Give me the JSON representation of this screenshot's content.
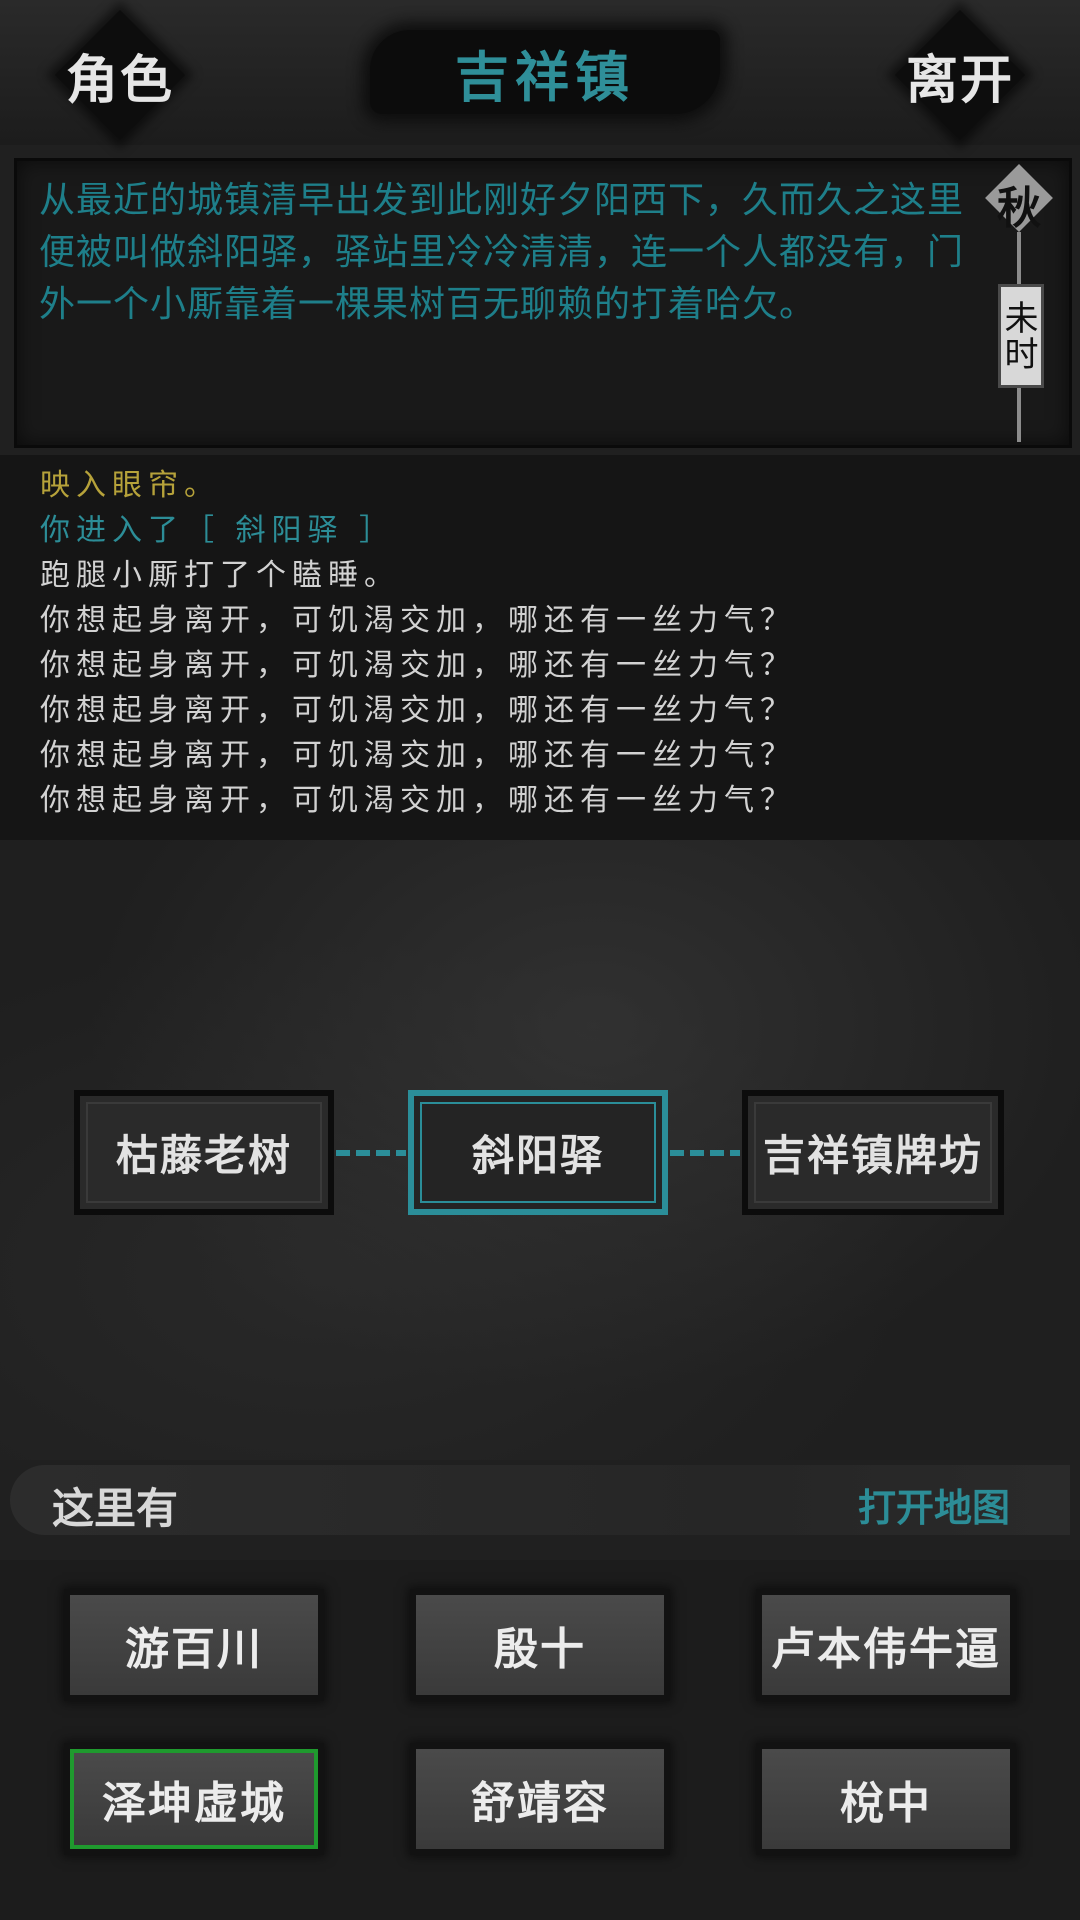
{
  "header": {
    "role_button": "角色",
    "title": "吉祥镇",
    "leave_button": "离开"
  },
  "description": {
    "text": "从最近的城镇清早出发到此刚好夕阳西下，久而久之这里便被叫做斜阳驿，驿站里冷冷清清，连一个人都没有，门外一个小厮靠着一棵果树百无聊赖的打着哈欠。"
  },
  "season": {
    "season": "秋",
    "time": "未时"
  },
  "log": {
    "lines": [
      "映入眼帘。",
      "你进入了［ 斜阳驿 ］",
      "跑腿小厮打了个瞌睡。",
      "你想起身离开，可饥渴交加，哪还有一丝力气？",
      "你想起身离开，可饥渴交加，哪还有一丝力气？",
      "你想起身离开，可饥渴交加，哪还有一丝力气？",
      "你想起身离开，可饥渴交加，哪还有一丝力气？",
      "你想起身离开，可饥渴交加，哪还有一丝力气？"
    ]
  },
  "map": {
    "left_node": "枯藤老树",
    "current_node": "斜阳驿",
    "right_node": "吉祥镇牌坊"
  },
  "here": {
    "label": "这里有",
    "open_map": "打开地图"
  },
  "npcs": {
    "items": [
      "游百川",
      "殷十",
      "卢本伟牛逼",
      "泽坤虚城",
      "舒靖容",
      "梲中"
    ],
    "selected": "泽坤虚城"
  },
  "colors": {
    "accent_teal": "#2c8d97",
    "log_yellow": "#b6a23a",
    "selected_green": "#1f9a2e"
  }
}
